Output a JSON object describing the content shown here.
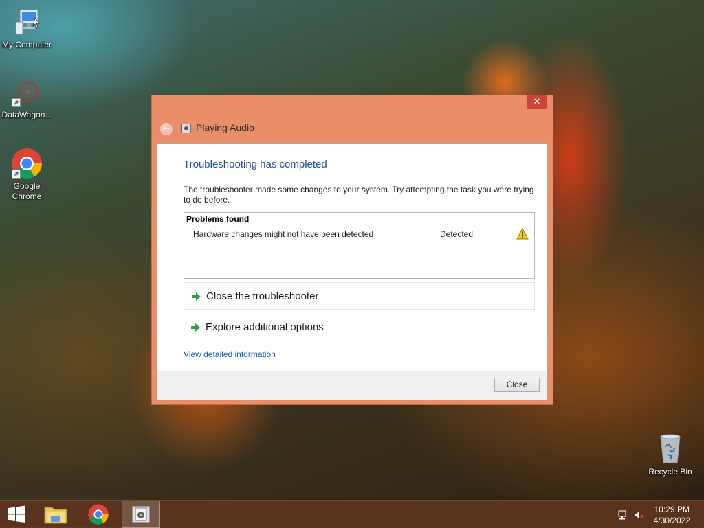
{
  "desktop": {
    "icons": [
      {
        "label": "My Computer"
      },
      {
        "label": "DataWagon..."
      },
      {
        "label": "Google Chrome"
      },
      {
        "label": "Recycle Bin"
      }
    ]
  },
  "window": {
    "title": "Playing Audio",
    "close_glyph": "✕",
    "heading": "Troubleshooting has completed",
    "description": "The troubleshooter made some changes to your system. Try attempting the task you were trying to do before.",
    "problems": {
      "title": "Problems found",
      "rows": [
        {
          "name": "Hardware changes might not have been detected",
          "status": "Detected",
          "icon": "warning-icon"
        }
      ]
    },
    "options": [
      {
        "label": "Close the troubleshooter",
        "icon": "green-arrow-icon"
      },
      {
        "label": "Explore additional options",
        "icon": "green-arrow-icon"
      }
    ],
    "detail_link": "View detailed information",
    "close_button": "Close"
  },
  "taskbar": {
    "items": [
      "start-button",
      "file-explorer",
      "google-chrome",
      "playing-audio-troubleshooter"
    ],
    "clock": {
      "time": "10:29 PM",
      "date": "4/30/2022"
    }
  },
  "colors": {
    "window_frame": "#e98e68",
    "heading": "#1d4f91",
    "link": "#1b64a8",
    "taskbar": "#5c341e"
  }
}
